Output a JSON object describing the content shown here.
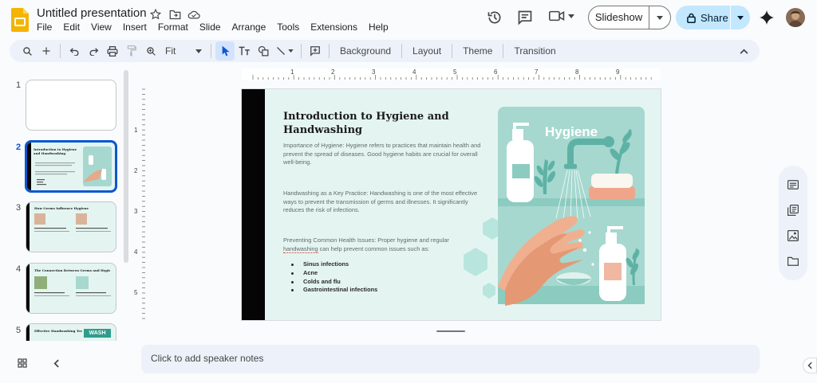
{
  "app": {
    "document_title": "Untitled presentation",
    "menus": [
      "File",
      "Edit",
      "View",
      "Insert",
      "Format",
      "Slide",
      "Arrange",
      "Tools",
      "Extensions",
      "Help"
    ]
  },
  "header": {
    "slideshow_label": "Slideshow",
    "share_label": "Share"
  },
  "toolbar": {
    "zoom_value": "Fit",
    "background_label": "Background",
    "layout_label": "Layout",
    "theme_label": "Theme",
    "transition_label": "Transition"
  },
  "filmstrip": {
    "slides": [
      {
        "number": "1",
        "title": ""
      },
      {
        "number": "2",
        "title": "Introduction to Hygiene and Handwashing"
      },
      {
        "number": "3",
        "title": "How Germs Influence Hygiene"
      },
      {
        "number": "4",
        "title": "The Connection Between Germs and Hygiene"
      },
      {
        "number": "5",
        "title": "Effective Handwashing Techniques",
        "badge": "WASH"
      }
    ]
  },
  "ruler": {
    "top_marks": [
      "1",
      "2",
      "3",
      "4",
      "5",
      "6",
      "7",
      "8",
      "9"
    ],
    "left_marks": [
      "1",
      "2",
      "3",
      "4",
      "5"
    ]
  },
  "slide": {
    "title": "Introduction to Hygiene and Handwashing",
    "para1": "Importance of Hygiene: Hygiene refers to practices that maintain health and prevent the spread of diseases. Good hygiene habits are crucial for overall well-being.",
    "para2": "Handwashing as a Key Practice: Handwashing is one of the most effective ways to prevent the transmission of germs and illnesses. It significantly reduces the risk of infections.",
    "para3": "Preventing Common Health Issues: Proper hygiene and regular handwashing can help prevent common issues such as:",
    "bullets": [
      "Sinus infections",
      "Acne",
      "Colds and flu",
      "Gastrointestinal infections"
    ],
    "image_heading": "Hygiene",
    "colors": {
      "background": "#e4f5f1",
      "accent_bar": "#050505",
      "panel": "#a6d8cf"
    }
  },
  "notes": {
    "placeholder": "Click to add speaker notes"
  }
}
